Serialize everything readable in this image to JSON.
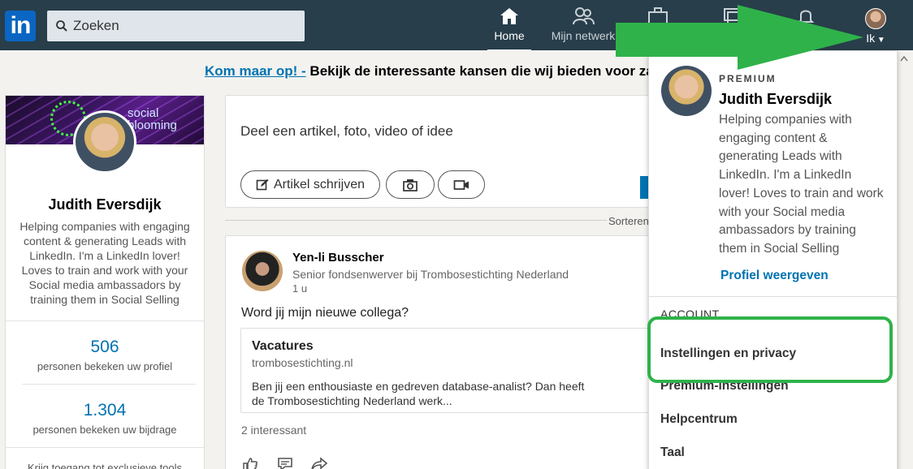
{
  "header": {
    "logo": "in",
    "search_placeholder": "Zoeken",
    "nav": {
      "home": "Home",
      "network": "Mijn netwerk",
      "me": "Ik"
    }
  },
  "promo": {
    "link": "Kom maar op! -",
    "text": " Bekijk de interessante kansen die wij bieden voor za"
  },
  "profile_card": {
    "banner_brand_line1": "social",
    "banner_brand_line2": "blooming",
    "name": "Judith Eversdijk",
    "headline": "Helping companies with engaging content & generating Leads with LinkedIn. I'm a LinkedIn lover! Loves to train and work with your Social media ambassadors by training them in Social Selling",
    "stat1_value": "506",
    "stat1_label": "personen bekeken uw profiel",
    "stat2_value": "1.304",
    "stat2_label": "personen bekeken uw bijdrage",
    "premium_teaser": "Krijg toegang tot exclusieve tools"
  },
  "composer": {
    "placeholder": "Deel een artikel, foto, video of idee",
    "article_button": "Artikel schrijven"
  },
  "feed": {
    "sort_label": "Sorteren"
  },
  "post": {
    "author": "Yen-li Busscher",
    "role": "Senior fondsenwerver bij Trombosestichting Nederland",
    "time": "1 u",
    "body": "Word jij mijn nieuwe collega?",
    "link_title": "Vacatures",
    "link_domain": "trombosestichting.nl",
    "link_desc": "Ben jij een enthousiaste en gedreven database-analist? Dan heeft de Trombosestichting Nederland werk...",
    "reactions": "2 interessant"
  },
  "dropdown": {
    "premium_label": "PREMIUM",
    "name": "Judith Eversdijk",
    "headline": "Helping companies with engaging content & generating Leads with LinkedIn. I'm a LinkedIn lover! Loves to train and work with your Social media ambassadors by training them in Social Selling",
    "view_profile": "Profiel weergeven",
    "section_account": "ACCOUNT",
    "items": [
      "Instellingen en privacy",
      "Premium-instellingen",
      "Helpcentrum",
      "Taal"
    ]
  },
  "colors": {
    "nav_bg": "#283e4a",
    "brand_blue": "#0073b1",
    "annotation_green": "#2fb24a"
  }
}
